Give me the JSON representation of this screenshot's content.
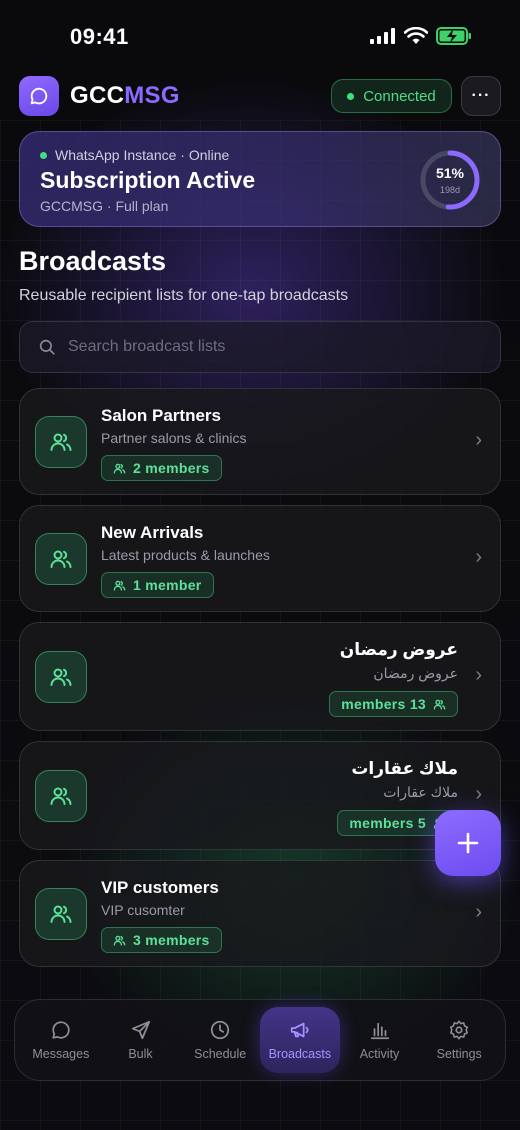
{
  "status_bar": {
    "time": "09:41"
  },
  "header": {
    "brand_prefix": "GCC",
    "brand_accent": "MSG",
    "connection_label": "Connected",
    "more_label": "···"
  },
  "subscription": {
    "instance_status": "WhatsApp Instance · Online",
    "title": "Subscription Active",
    "plan": "GCCMSG · Full plan",
    "progress_percent": 51,
    "progress_label": "51%",
    "days_label": "198d"
  },
  "page": {
    "title": "Broadcasts",
    "subtitle": "Reusable recipient lists for one-tap broadcasts"
  },
  "search": {
    "placeholder": "Search broadcast lists",
    "value": ""
  },
  "lists": [
    {
      "name": "Salon Partners",
      "description": "Partner salons & clinics",
      "members": "2 members"
    },
    {
      "name": "New Arrivals",
      "description": "Latest products & launches",
      "members": "1 member"
    },
    {
      "name": "عروض رمضان",
      "description": "عروض رمضان",
      "members": "members 13"
    },
    {
      "name": "ملاك عقارات",
      "description": "ملاك عقارات",
      "members": "members 5"
    },
    {
      "name": "VIP customers",
      "description": "VIP cusomter",
      "members": "3 members"
    }
  ],
  "fab": {
    "icon": "plus-icon"
  },
  "nav": {
    "items": [
      {
        "label": "Messages",
        "icon": "chat-bubble-icon"
      },
      {
        "label": "Bulk",
        "icon": "send-icon"
      },
      {
        "label": "Schedule",
        "icon": "clock-icon"
      },
      {
        "label": "Broadcasts",
        "icon": "megaphone-icon"
      },
      {
        "label": "Activity",
        "icon": "bar-chart-icon"
      },
      {
        "label": "Settings",
        "icon": "gear-icon"
      }
    ],
    "active": "Broadcasts"
  },
  "colors": {
    "accent": "#8b6bff",
    "online": "#3ee07f",
    "member_pill_text": "#5fe09a"
  }
}
